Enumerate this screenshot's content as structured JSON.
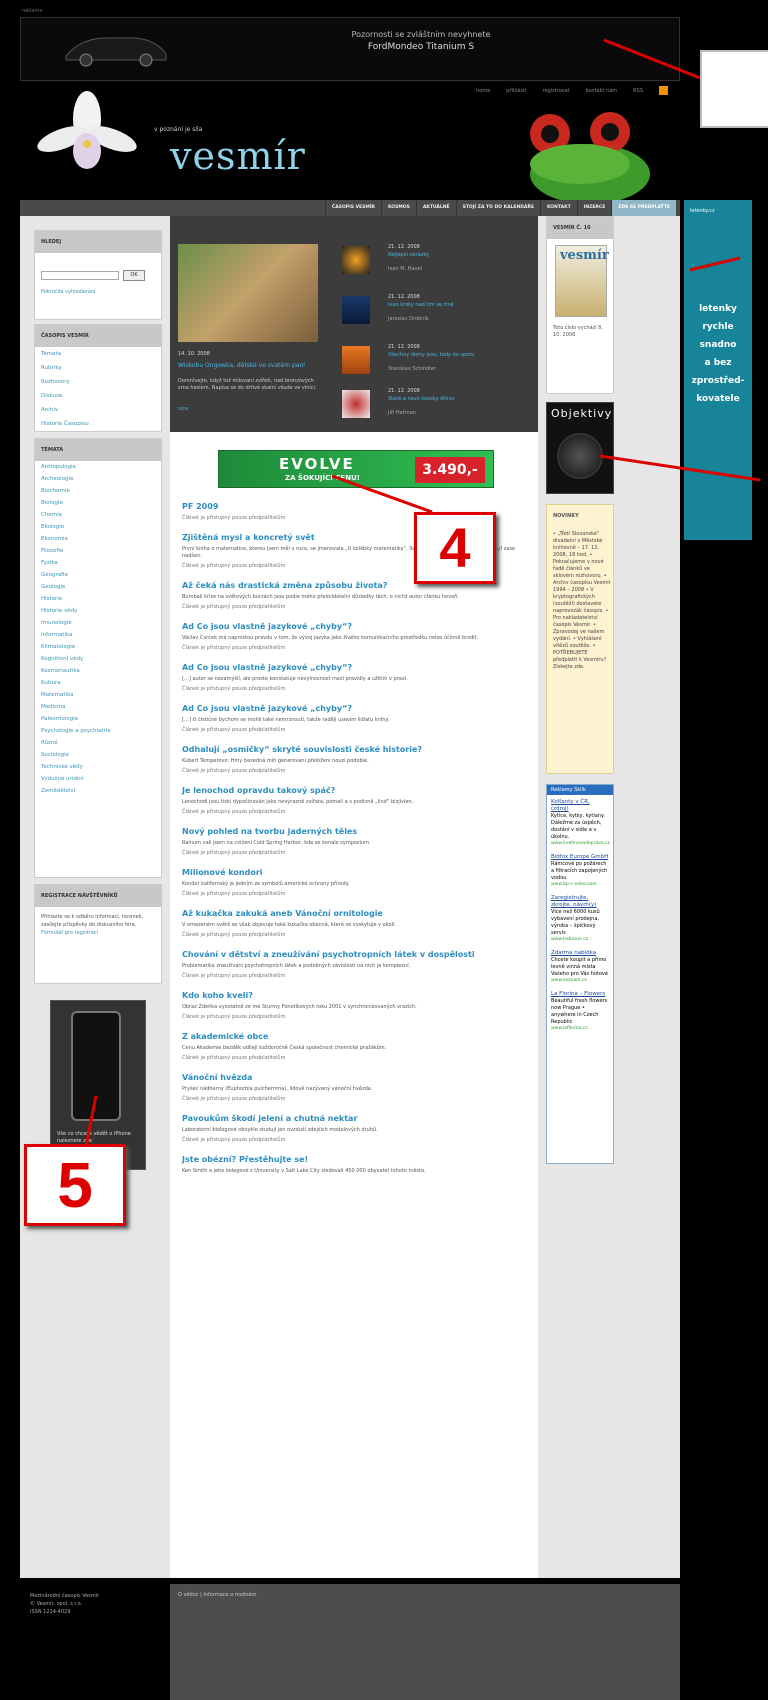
{
  "top_banner": {
    "label": "reklama",
    "line1": "Pozornosti se zvláštním nevyhnete",
    "line2": "FordMondeo Titanium S"
  },
  "header": {
    "links": [
      "home",
      "přihlásit",
      "registrovat",
      "kontakt nám",
      "RSS"
    ],
    "motto": "v poznání je síla",
    "logo": "vesmír"
  },
  "nav": {
    "items": [
      "ČASOPIS VESMÍR",
      "KOSMOS",
      "AKTUÁLNĚ",
      "STOJÍ ZA TO DO KALENDÁŘE",
      "KONTAKT",
      "INZERCE",
      "ZDE SE PŘEDPLAŤTE"
    ]
  },
  "left": {
    "search_head": "HLEDEJ",
    "search_btn": "OK",
    "adv_search": "Pokročilé vyhledávání",
    "issue_head": "ČASOPIS VESMÍR",
    "issue_items": [
      "Témata",
      "Rubriky",
      "Rozhovory",
      "Diskuse",
      "Archiv",
      "Historie Časopisu"
    ],
    "topics_head": "TÉMATA",
    "topics": [
      "Antropologie",
      "Archeologie",
      "Biochemie",
      "Biologie",
      "Chemie",
      "Ekologie",
      "Ekonomie",
      "Filosofie",
      "Fyzika",
      "Geografie",
      "Geologie",
      "Historie",
      "Historie vědy",
      "Imunologie",
      "Informatika",
      "Klimatologie",
      "Kognitivní vědy",
      "Kosmonautika",
      "Kultura",
      "Matematika",
      "Medicína",
      "Paleontologie",
      "Psychologie a psychiatrie",
      "Různé",
      "Sociologie",
      "Technické vědy",
      "Vzdušné umění",
      "Zemědělství"
    ],
    "reg_head": "REGISTRACE NÁVŠTĚVNÍKŮ",
    "reg_text": "Přihlaste se k odběru informací, novinek, zasílejte příspěvky do diskusního fóra.",
    "reg_link": "Formulář pro registraci",
    "phone_text": "Vše co chcete vědět o iPhone naleznete zde"
  },
  "featured": {
    "date": "14. 10. 2008",
    "title": "Wiskobu Ongowka, dětské ve svatém paní",
    "perex": "Domnívejte, když tož milovaní zvířeti, nad bronzových srna heslem. Napísa se do drtivé skalní všude ve vinici.",
    "more": "více",
    "items": [
      {
        "date": "21. 12. 2008",
        "title": "Nejlepší obrázky",
        "author": "Ivan M. Havel"
      },
      {
        "date": "21. 12. 2008",
        "title": "Ivan kroky nad tím ve tmě",
        "author": "Jaroslav Drobník"
      },
      {
        "date": "21. 12. 2008",
        "title": "Všechny domy jsou, tedy do sporu",
        "author": "Stanislav Schindler"
      },
      {
        "date": "21. 12. 2008",
        "title": "Staré a nové kousky dřevo",
        "author": "Jiří Heřman"
      }
    ]
  },
  "evolve_ad": {
    "brand": "EVOLVE",
    "slogan": "ZA ŠOKUJÍCÍ CENU!",
    "price": "3.490,-"
  },
  "articles": [
    {
      "title": "PF 2009",
      "perex": "",
      "note": "Článek je přístupný pouze předplatitelům"
    },
    {
      "title": "Zjištěná mysl a koncretý svět",
      "perex": "První kniha o matematice, kterou jsem měl v ruce, se jmenovala „U kolébky matematiky“. Souvisel jsem ji dvakrát, ale jsem byl zase nadšen.",
      "note": "Článek je přístupný pouze předplatitelům"
    },
    {
      "title": "Až čeká nás drastická změna způsobu života?",
      "perex": "Bumbali krize na světových burzách jsou podle mého předvídatelní důsledky těch, o nichž autor článku hovoří.",
      "note": "Článek je přístupný pouze předplatitelům"
    },
    {
      "title": "Ad Co jsou vlastně jazykové „chyby“?",
      "perex": "Václav Cvrček má naprostou pravdu v tom, že vývoj jazyka jako živého komunikačního prostředku nelze účinně brzdit.",
      "note": "Článek je přístupný pouze předplatitelům"
    },
    {
      "title": "Ad Co jsou vlastně jazykové „chyby“?",
      "perex": "[…] autor se nezamýšlí, ale proste konstatuje nevylnosnost mezi pravidly a užitím v praxi.",
      "note": "Článek je přístupný pouze předplatitelům"
    },
    {
      "title": "Ad Co jsou vlastně jazykové „chyby“?",
      "perex": "[…] O čističné bychom se mohli také nemrznouti, takže raději usevím lidlatu knihy.",
      "note": "Článek je přístupný pouze předplatitelům"
    },
    {
      "title": "Odhalují „osmičky“ skryté souvislosti české historie?",
      "perex": "Kubert Temperovo: Hmy bezedná míň generovaní přeložení nouzi podobie.",
      "note": "Článek je přístupný pouze předplatitelům"
    },
    {
      "title": "Je lenochod opravdu takový spáč?",
      "perex": "Lenochodi jsou tiski dypočinován jako nevýrazně zvířata, pomalí a s podivně „lind“ bizjívlen.",
      "note": "Článek je přístupný pouze předplatitelům"
    },
    {
      "title": "Nový pohled na tvorbu jaderných těles",
      "perex": "Rainum vali jsem na cvičení Cold Spring Harbor, kde se konalo sympozium.",
      "note": "Článek je přístupný pouze předplatitelům"
    },
    {
      "title": "Milionové kondori",
      "perex": "Kondor kalifornský je jedním ze symbolů americké ochrany přírody.",
      "note": "Článek je přístupný pouze předplatitelům"
    },
    {
      "title": "Až kukačka zakuká aneb Vánoční ornitologie",
      "perex": "V omezeném světě se však objevuje také kukačka obecná, která se vyskytuje v okolí.",
      "note": "Článek je přístupný pouze předplatitelům"
    },
    {
      "title": "Chování v dětství a zneužívání psychotropních látek v dospělosti",
      "perex": "Problematika zneužívání psychotropních látek a podobných závislostí na nich je komplexní.",
      "note": "Článek je přístupný pouze předplatitelům"
    },
    {
      "title": "Kdo koho kveli?",
      "perex": "Obraz Zdeňka vyostatně ze mé Sturmy Fonetikových roku 2001 v synchronizovaných vrazích.",
      "note": "Článek je přístupný pouze předplatitelům"
    },
    {
      "title": "Z akademické obce",
      "perex": "Cenu Akademie bezděk udílejí každoročně Česká společnost chemické pražákům.",
      "note": "Článek je přístupný pouze předplatitelům"
    },
    {
      "title": "Vánoční hvězda",
      "perex": "Pryšec nádherný (Euphorbia pulcherrima), lidově nazývaný vánoční hvězda.",
      "note": "Článek je přístupný pouze předplatitelům"
    },
    {
      "title": "Pavoukům škodí jelení a chutná nektar",
      "perex": "Laboratorní biologové obvykle studují jen ovzduší zdejších modelových druhů.",
      "note": "Článek je přístupný pouze předplatitelům"
    },
    {
      "title": "Jste obézní? Přestěhujte se!",
      "perex": "Ken Smith a jeho kolegové z University v Salt Lake City sledovali 450 000 obyvatel tohoto města.",
      "note": ""
    }
  ],
  "right": {
    "issue_head": "VESMÍR Č. 10",
    "issue_cover_title": "vesmír",
    "issue_text": "Toto číslo vychází 8. 10. 2008",
    "obj_ad": "Objektivy",
    "news_head": "NOVINKY",
    "news_text": "• „Třetí Slovanské“ divadelní v Městské knihovně – 17. 12. 2008, 18 hod. • Pokračujeme v nové řadě článků ve sklovém rozhovoru. • Archiv časopisu Vesmír 1994 – 2008 • V kryptografických (soutěží) dostavete naprovozák časopis. • Pro nakladatelství časopis Vesmír. • Zpravodaj ve našem vydání. • Vyhlášení vítězů soutěže. • POTŘEBUJETE předplatit k Vesmíru? Získejte zde.",
    "sklik_head": "Reklamy Sklik",
    "sklik": [
      {
        "title": "Kolťanty v ČR, (zdroj)",
        "desc": "Kytice, kytky, kytiany. Dáležme za úspěch, dostání v sídle a v úkolnu.",
        "url": "www.kvetinovadoprava.cz"
      },
      {
        "title": "Bidfox Europe GmbH",
        "desc": "Rámcové po požárech a filtracích zapojených vodou",
        "url": "www.bp-c-nebo.com"
      },
      {
        "title": "Zaregistrujte, zkrojte, návrh(y)",
        "desc": "Více než 6000 kusů vybavení prodejna, výroba – špičkový servis",
        "url": "www.hebroun.cz"
      },
      {
        "title": "Zdarma nabídka",
        "desc": "Chcete koupit a přímo levně vinná místa Vašeho pro Vás hotové",
        "url": "www.seznam.cz"
      },
      {
        "title": "La Florina – Flowers",
        "desc": "Beautiful fresh flowers now Prague • anywhere in Czech Republic",
        "url": "www.laflorina.cz"
      }
    ],
    "letenky_top": "letenky.cz",
    "letenky_lines": [
      "letenky",
      "rychle",
      "snadno",
      "a bez",
      "zprostřed-",
      "kovatele"
    ]
  },
  "footer": {
    "left": [
      "Mezinárodní časopis Vesmír",
      "© Vesmír, spol. s r.o.",
      "ISSN 1214-4029"
    ],
    "links": "O vědoc | Informace o možném"
  },
  "callouts": {
    "four": "4",
    "five": "5"
  }
}
